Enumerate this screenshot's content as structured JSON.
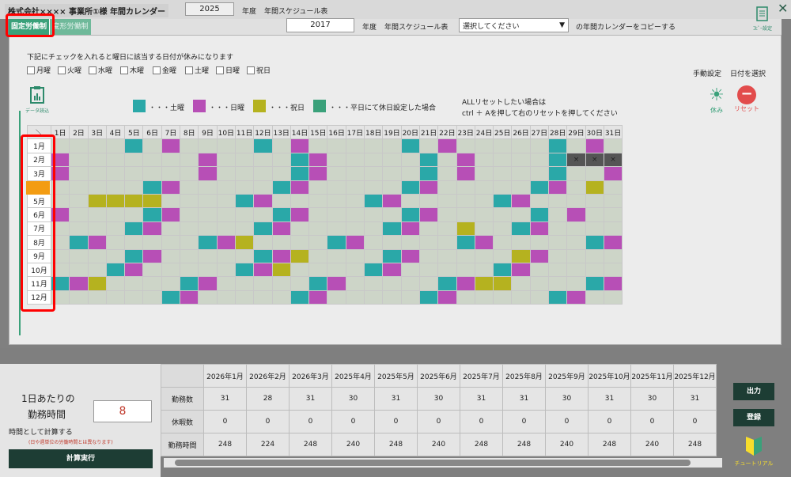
{
  "header": {
    "company": "株式会社×××× 事業所①様 年間カレンダー",
    "year": "2025",
    "year_label": "年度",
    "sched_label": "年間スケジュール表",
    "copy_year": "2017",
    "copy_year_label": "年度",
    "copy_sched_label": "年間スケジュール表",
    "select_placeholder": "選択してください",
    "copy_suffix": "の年間カレンダーをコピーする",
    "copy_icon_label": "ｺﾋﾟｰ設定",
    "close": "✕"
  },
  "tabs": {
    "fixed": "固定労働制",
    "variable": "変形労働制"
  },
  "instructions": "下記にチェックを入れると曜日に該当する日付が休みになります",
  "weekdays": [
    "月曜",
    "火曜",
    "水曜",
    "木曜",
    "金曜",
    "土曜",
    "日曜",
    "祝日"
  ],
  "manual": {
    "label": "手動設定",
    "select_label": "日付を選択"
  },
  "data_read": "データ読込",
  "legend": {
    "sat": "・・・土曜",
    "sun": "・・・日曜",
    "hol": "・・・祝日",
    "weekday_off": "・・・平日にて休日設定した場合"
  },
  "reset_note": {
    "line1": "ALLリセットしたい場合は",
    "line2": "ctrl ＋ Aを押して右のリセットを押してください"
  },
  "rest_label": "休み",
  "reset_label": "リセット",
  "days": [
    "1日",
    "2日",
    "3日",
    "4日",
    "5日",
    "6日",
    "7日",
    "8日",
    "9日",
    "10日",
    "11日",
    "12日",
    "13日",
    "14日",
    "15日",
    "16日",
    "17日",
    "18日",
    "19日",
    "20日",
    "21日",
    "22日",
    "23日",
    "24日",
    "25日",
    "26日",
    "27日",
    "28日",
    "29日",
    "30日",
    "31日"
  ],
  "months": [
    "1月",
    "2月",
    "3月",
    "4月",
    "5月",
    "6月",
    "7月",
    "8月",
    "9月",
    "10月",
    "11月",
    "12月"
  ],
  "grid": [
    "0000T0S0000T0S00000T0S00000T0S00000TS00000TX",
    "S0000000S0000TS00000T0S0000TXXX",
    "S0000000S0000TS00000T0S0000T00S",
    "00000TS00000TS00000TS00000TS0H0X",
    "00HHHH0000TS00000TS00000TS00000T",
    "S0000TS00000TS00000TS00000T0S00X",
    "0000TS00000TS00000TS00H00TS00000",
    "0TS00000TSH0000TS00000TS00000TS",
    "0000TS00000TSH0000TS00000HS0000TX",
    "000TS00000TSH0000TS00000TS00000",
    "TSH0000TS00000TS00000TSHH0000TSX",
    "000000TS00000TS00000TS00000TS000"
  ],
  "side": {
    "per_day_label1": "1日あたりの",
    "per_day_label2": "勤務時間",
    "hours_value": "8",
    "calc_note": "時間として計算する",
    "calc_subnote": "(日や週単位の労働時間とは異なります)",
    "calc_button": "計算実行"
  },
  "summary": {
    "cols": [
      "2026年1月",
      "2026年2月",
      "2026年3月",
      "2025年4月",
      "2025年5月",
      "2025年6月",
      "2025年7月",
      "2025年8月",
      "2025年9月",
      "2025年10月",
      "2025年11月",
      "2025年12月"
    ],
    "rows": [
      {
        "label": "勤務数",
        "values": [
          "31",
          "28",
          "31",
          "30",
          "31",
          "30",
          "31",
          "31",
          "30",
          "31",
          "30",
          "31"
        ]
      },
      {
        "label": "休暇数",
        "values": [
          "0",
          "0",
          "0",
          "0",
          "0",
          "0",
          "0",
          "0",
          "0",
          "0",
          "0",
          "0"
        ]
      },
      {
        "label": "勤務時間",
        "values": [
          "248",
          "224",
          "248",
          "240",
          "248",
          "240",
          "248",
          "248",
          "240",
          "248",
          "240",
          "248"
        ]
      }
    ]
  },
  "right": {
    "output": "出力",
    "register": "登録",
    "tutorial": "チュートリアル"
  },
  "colors": {
    "sat": "#2aa8a8",
    "sun": "#b74fb6",
    "hol": "#b5b21f",
    "weekday_off": "#3aa17a"
  }
}
